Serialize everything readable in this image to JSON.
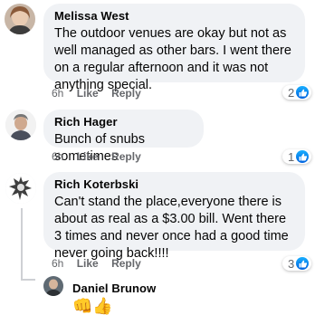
{
  "comments": [
    {
      "name": "Melissa West",
      "text": "The outdoor venues are okay but not as well managed as other bars.  I went there on a regular afternoon and it was not anything special.",
      "time": "6h",
      "like": "Like",
      "reply": "Reply",
      "reactions": "2"
    },
    {
      "name": "Rich Hager",
      "text": "Bunch of snubs sometimes",
      "time": "6h",
      "like": "Like",
      "reply": "Reply",
      "reactions": "1"
    },
    {
      "name": "Rich Koterbski",
      "text": "Can't stand the place,everyone there is about as real as a $3.00 bill. Went there 3 times and never once had a good time never going back!!!!",
      "time": "6h",
      "like": "Like",
      "reply": "Reply",
      "reactions": "3"
    }
  ],
  "reply": {
    "name": "Daniel Brunow",
    "emoji": "👊👍"
  },
  "colors": {
    "bubble": "#f0f2f5",
    "meta": "#65676b",
    "like_blue": "#1877f2"
  },
  "icons": [
    "like-reaction-icon"
  ]
}
